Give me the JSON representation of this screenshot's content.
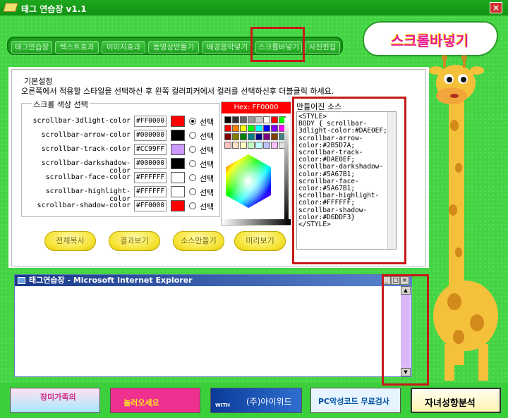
{
  "window": {
    "title": "태그 연습장 v1.1",
    "close": "×"
  },
  "tabs": [
    "태그연습장",
    "텍스트효과",
    "이미지효과",
    "동영상만들기",
    "배경음악넣기",
    "스크롤바넣기",
    "사진편집"
  ],
  "logo": {
    "text": "스크롤바넣기"
  },
  "basic": {
    "legend": "기본설정",
    "description": "오른쪽에서 적용할 스타일을 선택하신 후 왼쪽 컬러피커에서 컬러를 선택하신후 더블클릭 하세요."
  },
  "color_section": {
    "legend": "스크롤 색상 선택",
    "select_label": "선택"
  },
  "rows": [
    {
      "name": "scrollbar-3dlight-color",
      "value": "#FF0000",
      "color": "#ff0000",
      "selected": true
    },
    {
      "name": "scrollbar-arrow-color",
      "value": "#000000",
      "color": "#000000",
      "selected": false
    },
    {
      "name": "scrollbar-track-color",
      "value": "#CC99FF",
      "color": "#cc99ff",
      "selected": false
    },
    {
      "name": "scrollbar-darkshadow-color",
      "value": "#000000",
      "color": "#000000",
      "selected": false
    },
    {
      "name": "scrollbar-face-color",
      "value": "#FFFFFF",
      "color": "#ffffff",
      "selected": false
    },
    {
      "name": "scrollbar-highlight-color",
      "value": "#FFFFFF",
      "color": "#ffffff",
      "selected": false
    },
    {
      "name": "scrollbar-shadow-color",
      "value": "#FF0000",
      "color": "#ff0000",
      "selected": false
    }
  ],
  "picker": {
    "hex": "Hex: FF0000"
  },
  "buttons": [
    "전체복사",
    "결과보기",
    "소스만들기",
    "미리보기"
  ],
  "source": {
    "label": "만들어진 소스",
    "code": "<STYLE>\nBODY { scrollbar-\n3dlight-color:#DAE0EF;\nscrollbar-arrow-\ncolor:#2B5D7A;\nscrollbar-track-\ncolor:#DAE0EF;\nscrollbar-darkshadow-\ncolor:#5A67B1;\nscrollbar-face-\ncolor:#5A67B1;\nscrollbar-highlight-\ncolor:#FFFFFF;\nscrollbar-shadow-\ncolor:#D6DDF3}\n</STYLE>"
  },
  "preview": {
    "title": "태그연습장 - Microsoft Internet Explorer",
    "min": "_",
    "max": "□",
    "close": "×",
    "up": "▲",
    "down": "▼"
  },
  "banners": [
    "장미가족의",
    "놀러오세요",
    "WITH",
    "(주)아이위드",
    "PC악성코드 무료검사",
    "자녀성향분석"
  ],
  "colors": {
    "track": "#cc99ff",
    "accent_red": "#c81818",
    "bg_green": "#44d444"
  }
}
